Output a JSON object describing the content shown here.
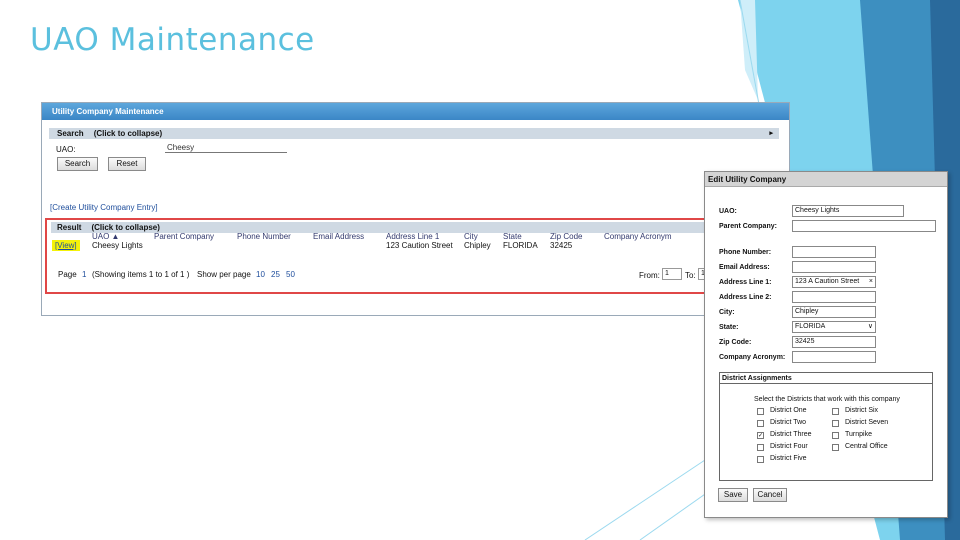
{
  "slide": {
    "title": "UAO Maintenance"
  },
  "colors": {
    "accent": "#5bc0de",
    "header_blue": "#3b86c6",
    "highlight_red": "#e04747",
    "view_highlight": "#f4f20a"
  },
  "main_window": {
    "title": "Utility Company Maintenance",
    "search_section": {
      "label": "Search",
      "toggle": "(Click to collapse)",
      "arrow": "▸"
    },
    "uao_label": "UAO:",
    "uao_value": "Cheesy",
    "search_button": "Search",
    "reset_button": "Reset",
    "create_link": "[Create Utility Company Entry]",
    "result_section": {
      "label": "Result",
      "toggle": "(Click to collapse)",
      "columns": [
        "UAO ▲",
        "Parent Company",
        "Phone Number",
        "Email Address",
        "Address Line 1",
        "City",
        "State",
        "Zip Code",
        "Company Acronym"
      ],
      "rows": [
        {
          "view": "[View]",
          "uao": "Cheesy Lights",
          "parent": "",
          "phone": "",
          "email": "",
          "address": "123 Caution Street",
          "city": "Chipley",
          "state": "FLORIDA",
          "zip": "32425",
          "acronym": ""
        }
      ],
      "pager": {
        "page_label": "Page",
        "page_num": "1",
        "showing": "(Showing items 1 to 1 of 1 )",
        "show_per_page": "Show per page",
        "per_page_options": [
          "10",
          "25",
          "50"
        ],
        "from_label": "From:",
        "from_value": "1",
        "to_label": "To:",
        "to_value": "1"
      }
    }
  },
  "edit_dialog": {
    "title": "Edit Utility Company",
    "fields": {
      "uao": {
        "label": "UAO:",
        "value": "Cheesy Lights"
      },
      "parent": {
        "label": "Parent Company:",
        "value": ""
      },
      "phone": {
        "label": "Phone Number:",
        "value": ""
      },
      "email": {
        "label": "Email Address:",
        "value": ""
      },
      "address1": {
        "label": "Address Line 1:",
        "value": "123 A Caution Street",
        "clear_icon": "×"
      },
      "address2": {
        "label": "Address Line 2:",
        "value": ""
      },
      "city": {
        "label": "City:",
        "value": "Chipley"
      },
      "state": {
        "label": "State:",
        "value": "FLORIDA",
        "arrow": "∨"
      },
      "zip": {
        "label": "Zip Code:",
        "value": "32425"
      },
      "acronym": {
        "label": "Company Acronym:",
        "value": ""
      }
    },
    "districts": {
      "title": "District Assignments",
      "instruction": "Select the Districts that work with this company",
      "items": [
        {
          "label": "District One",
          "checked": false,
          "mark": ""
        },
        {
          "label": "District Two",
          "checked": false,
          "mark": ""
        },
        {
          "label": "District Three",
          "checked": true,
          "mark": "✓"
        },
        {
          "label": "District Four",
          "checked": false,
          "mark": ""
        },
        {
          "label": "District Five",
          "checked": false,
          "mark": ""
        },
        {
          "label": "District Six",
          "checked": false,
          "mark": ""
        },
        {
          "label": "District Seven",
          "checked": false,
          "mark": ""
        },
        {
          "label": "Turnpike",
          "checked": false,
          "mark": ""
        },
        {
          "label": "Central Office",
          "checked": false,
          "mark": ""
        }
      ]
    },
    "save_button": "Save",
    "cancel_button": "Cancel"
  }
}
